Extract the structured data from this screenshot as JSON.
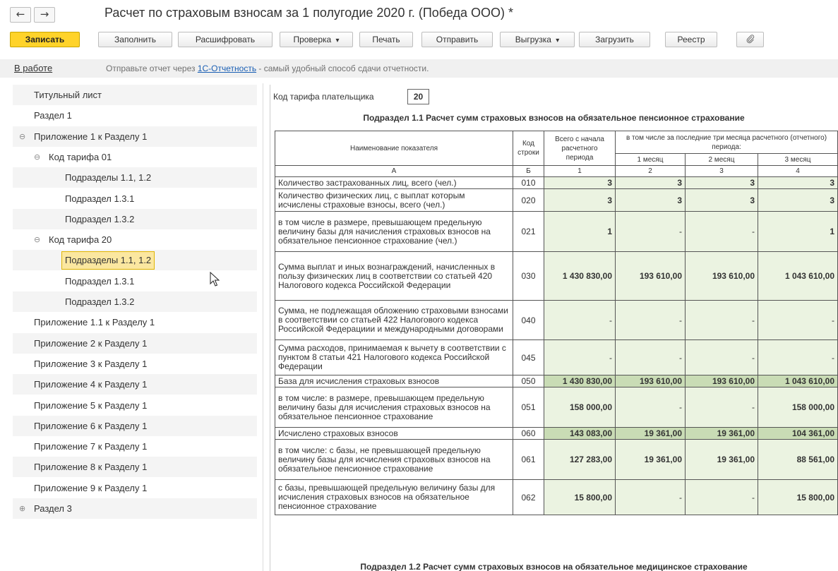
{
  "window": {
    "title": "Расчет по страховым взносам за 1 полугодие 2020 г. (Победа ООО) *",
    "back_icon": "←",
    "forward_icon": "→"
  },
  "toolbar": {
    "save": "Записать",
    "fill": "Заполнить",
    "decode": "Расшифровать",
    "check": "Проверка",
    "print": "Печать",
    "send": "Отправить",
    "export": "Выгрузка",
    "load": "Загрузить",
    "registry": "Реестр",
    "attach_icon": "paperclip-icon",
    "dropdown_glyph": "▾"
  },
  "status": {
    "state": "В работе",
    "msg_before": "Отправьте отчет через ",
    "msg_link": "1С-Отчетность",
    "msg_after": " - самый удобный способ сдачи отчетности."
  },
  "tree": {
    "items": [
      {
        "label": "Титульный лист",
        "level": 0,
        "toggle": ""
      },
      {
        "label": "Раздел 1",
        "level": 0,
        "toggle": ""
      },
      {
        "label": "Приложение 1 к Разделу 1",
        "level": 0,
        "toggle": "⊖"
      },
      {
        "label": "Код тарифа 01",
        "level": 1,
        "toggle": "⊖"
      },
      {
        "label": "Подразделы 1.1, 1.2",
        "level": 2,
        "toggle": ""
      },
      {
        "label": "Подраздел 1.3.1",
        "level": 2,
        "toggle": ""
      },
      {
        "label": "Подраздел 1.3.2",
        "level": 2,
        "toggle": ""
      },
      {
        "label": "Код тарифа 20",
        "level": 1,
        "toggle": "⊖"
      },
      {
        "label": "Подразделы 1.1, 1.2",
        "level": 2,
        "toggle": "",
        "selected": true
      },
      {
        "label": "Подраздел 1.3.1",
        "level": 2,
        "toggle": ""
      },
      {
        "label": "Подраздел 1.3.2",
        "level": 2,
        "toggle": ""
      },
      {
        "label": "Приложение 1.1 к Разделу 1",
        "level": 0,
        "toggle": ""
      },
      {
        "label": "Приложение 2 к Разделу 1",
        "level": 0,
        "toggle": ""
      },
      {
        "label": "Приложение 3 к Разделу 1",
        "level": 0,
        "toggle": ""
      },
      {
        "label": "Приложение 4 к Разделу 1",
        "level": 0,
        "toggle": ""
      },
      {
        "label": "Приложение 5 к Разделу 1",
        "level": 0,
        "toggle": ""
      },
      {
        "label": "Приложение 6 к Разделу 1",
        "level": 0,
        "toggle": ""
      },
      {
        "label": "Приложение 7 к Разделу 1",
        "level": 0,
        "toggle": ""
      },
      {
        "label": "Приложение 8 к Разделу 1",
        "level": 0,
        "toggle": ""
      },
      {
        "label": "Приложение 9 к Разделу 1",
        "level": 0,
        "toggle": ""
      },
      {
        "label": "Раздел 3",
        "level": 0,
        "toggle": "⊕"
      }
    ]
  },
  "form": {
    "tariff_label": "Код тарифа плательщика",
    "tariff_value": "20",
    "subsection_title": "Подраздел 1.1 Расчет сумм страховых взносов на обязательное пенсионное страхование",
    "next_subsection_title": "Подраздел 1.2 Расчет сумм страховых взносов на обязательное медицинское страхование",
    "headers": {
      "name": "Наименование показателя",
      "code": "Код строки",
      "total": "Всего с начала расчетного периода",
      "last3": "в том числе за последние три месяца расчетного (отчетного) периода:",
      "m1": "1 месяц",
      "m2": "2 месяц",
      "m3": "3 месяц",
      "letters": [
        "А",
        "Б",
        "1",
        "2",
        "3",
        "4"
      ]
    },
    "rows": [
      {
        "name": "Количество застрахованных лиц, всего (чел.)",
        "code": "010",
        "v": [
          "3",
          "3",
          "3",
          "3"
        ]
      },
      {
        "name": "Количество физических лиц, с выплат которым исчислены страховые взносы, всего (чел.)",
        "code": "020",
        "v": [
          "3",
          "3",
          "3",
          "3"
        ]
      },
      {
        "name": "в том числе в размере, превышающем предельную величину базы для начисления страховых взносов на обязательное пенсионное страхование (чел.)",
        "code": "021",
        "v": [
          "1",
          "-",
          "-",
          "1"
        ]
      },
      {
        "name": "Сумма выплат и иных вознаграждений, начисленных в пользу физических лиц в соответствии со статьей 420 Налогового кодекса Российской Федерации",
        "code": "030",
        "v": [
          "1 430 830,00",
          "193 610,00",
          "193 610,00",
          "1 043 610,00"
        ]
      },
      {
        "name": "Сумма, не подлежащая обложению страховыми взносами в соответствии со статьей 422 Налогового кодекса Российской Федерациии и международными договорами",
        "code": "040",
        "v": [
          "-",
          "-",
          "-",
          "-"
        ]
      },
      {
        "name": "Сумма расходов, принимаемая к вычету в соответствии с пунктом 8 статьи 421 Налогового кодекса Российской Федерации",
        "code": "045",
        "v": [
          "-",
          "-",
          "-",
          "-"
        ]
      },
      {
        "name": "База для исчисления страховых взносов",
        "code": "050",
        "v": [
          "1 430 830,00",
          "193 610,00",
          "193 610,00",
          "1 043 610,00"
        ],
        "dark": true
      },
      {
        "name": "в том числе: в размере, превышающем предельную величину базы для исчисления страховых взносов на обязательное пенсионное страхование",
        "code": "051",
        "v": [
          "158 000,00",
          "-",
          "-",
          "158 000,00"
        ]
      },
      {
        "name": "Исчислено страховых взносов",
        "code": "060",
        "v": [
          "143 083,00",
          "19 361,00",
          "19 361,00",
          "104 361,00"
        ],
        "dark": true
      },
      {
        "name": "в том числе: с базы, не превышающей предельную величину базы для исчисления страховых взносов на обязательное пенсионное страхование",
        "code": "061",
        "v": [
          "127 283,00",
          "19 361,00",
          "19 361,00",
          "88 561,00"
        ]
      },
      {
        "name": "с базы, превышающей предельную величину базы для исчисления страховых взносов на обязательное пенсионное страхование",
        "code": "062",
        "v": [
          "15 800,00",
          "-",
          "-",
          "15 800,00"
        ]
      }
    ]
  },
  "colors": {
    "primary_button": "#ffd32a",
    "cell_light_green": "#ebf3e1",
    "cell_dark_green": "#c9dcb5",
    "selected_item": "#fbe7a0"
  }
}
